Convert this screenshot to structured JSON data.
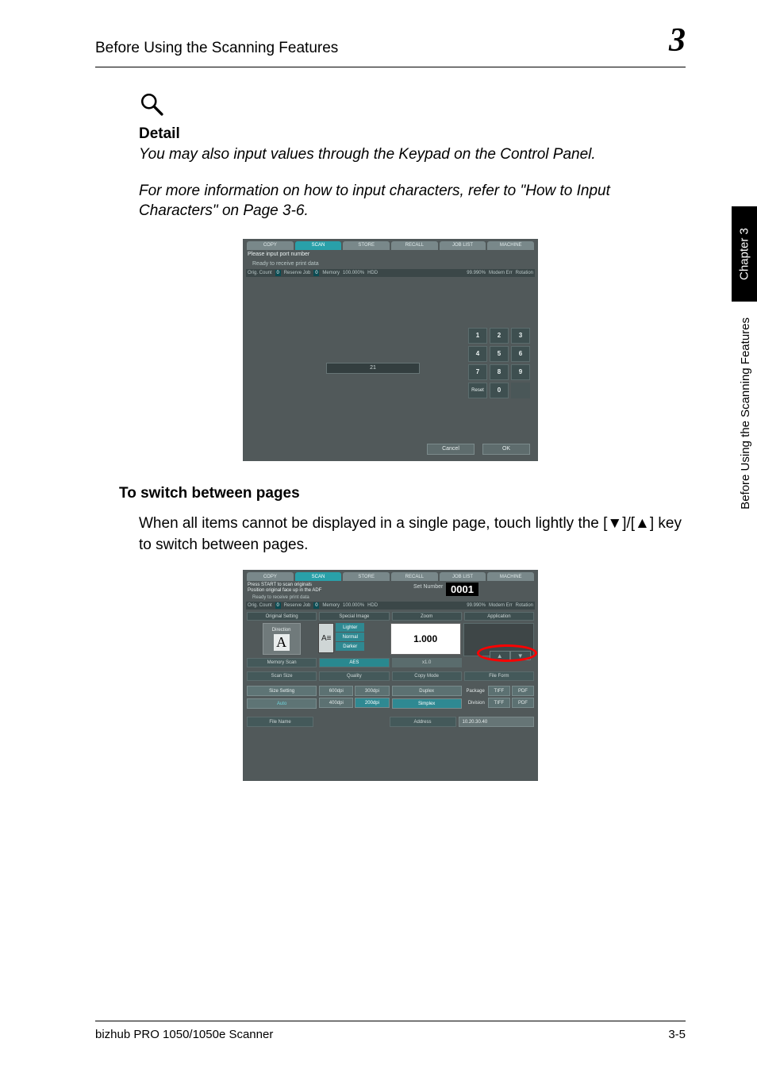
{
  "header": {
    "title": "Before Using the Scanning Features",
    "chapter_number": "3"
  },
  "detail": {
    "icon": "magnifier-icon",
    "heading": "Detail",
    "line1": "You may also input values through the Keypad on the Control Panel.",
    "line2": "For more information on how to input characters, refer to \"How to Input Characters\" on Page 3-6."
  },
  "screenshot1": {
    "tabs": [
      "COPY",
      "SCAN",
      "STORE",
      "RECALL",
      "JOB LIST",
      "MACHINE"
    ],
    "active_tab_index": 1,
    "instruction": "Please input port number",
    "ready": "Ready to receive print data",
    "status": {
      "orig_count_label": "Orig. Count",
      "orig_count": "0",
      "reserve_label": "Reserve Job",
      "reserve": "0",
      "memory_label": "Memory",
      "memory": "100.000%",
      "hdd_label": "HDD",
      "hdd": "99.990%",
      "modem": "Modem Err",
      "rotation": "Rotation"
    },
    "input_value": "21",
    "keypad": [
      "1",
      "2",
      "3",
      "4",
      "5",
      "6",
      "7",
      "8",
      "9",
      "Reset",
      "0",
      ""
    ],
    "cancel": "Cancel",
    "ok": "OK"
  },
  "section2": {
    "heading": "To switch between pages",
    "text": "When all items cannot be displayed in a single page, touch lightly the [▼]/[▲] key to switch between pages."
  },
  "screenshot2": {
    "tabs": [
      "COPY",
      "SCAN",
      "STORE",
      "RECALL",
      "JOB LIST",
      "MACHINE"
    ],
    "active_tab_index": 1,
    "instruction_l1": "Press START to scan originals",
    "instruction_l2": "Position original face up in the ADF",
    "ready": "Ready to receive print data",
    "set_number_label": "Set Number",
    "set_number_value": "0001",
    "status": {
      "orig_count_label": "Orig. Count",
      "orig_count": "0",
      "reserve_label": "Reserve Job",
      "reserve": "0",
      "memory_label": "Memory",
      "memory": "100.000%",
      "hdd_label": "HDD",
      "hdd": "99.990%",
      "modem": "Modem Err",
      "rotation": "Rotation"
    },
    "headers": [
      "Original Setting",
      "Special Image",
      "Zoom",
      "Application"
    ],
    "direction_label": "Direction",
    "direction_value": "A",
    "orient_icon": "A≡",
    "lnd": [
      "Lighter",
      "Normal",
      "Darker"
    ],
    "zoom_value": "1.000",
    "arrows": {
      "up": "▲",
      "down": "▼"
    },
    "row2": {
      "memory_scan": "Memory Scan",
      "aes": "AES",
      "x1": "x1.0"
    },
    "row3_headers": [
      "Scan Size",
      "Quality",
      "Copy Mode",
      "File Form"
    ],
    "scan": {
      "size_setting": "Size Setting",
      "auto": "Auto"
    },
    "quality": {
      "q600": "600dpi",
      "q300": "300dpi",
      "q400": "400dpi",
      "q200": "200dpi",
      "selected": "200dpi"
    },
    "copy_mode": {
      "duplex": "Duplex",
      "simplex": "Simplex",
      "selected": "Simplex"
    },
    "file_form": {
      "row1": {
        "lbl": "Package",
        "tiff": "TIFF",
        "pdf": "PDF"
      },
      "row2": {
        "lbl": "Division",
        "tiff": "TIFF",
        "pdf": "PDF"
      }
    },
    "file_name_label": "File Name",
    "address_label": "Address",
    "address_value": "10.20.30.40"
  },
  "side": {
    "tab": "Chapter 3",
    "text": "Before Using the Scanning Features"
  },
  "footer": {
    "left": "bizhub PRO 1050/1050e Scanner",
    "right": "3-5"
  }
}
